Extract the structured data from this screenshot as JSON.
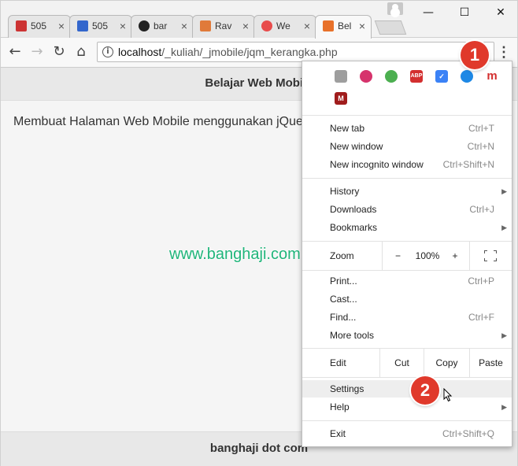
{
  "tabs": [
    {
      "title": "505",
      "favicon_color": "#cc3333"
    },
    {
      "title": "505",
      "favicon_color": "#3366cc"
    },
    {
      "title": "bar",
      "favicon_color": "#222222"
    },
    {
      "title": "Rav",
      "favicon_color": "#e07a3a"
    },
    {
      "title": "We",
      "favicon_color": "#e84c4c"
    },
    {
      "title": "Bel",
      "favicon_color": "#e8712a"
    }
  ],
  "window_controls": {
    "minimize": "—",
    "maximize": "☐",
    "close": "✕"
  },
  "toolbar": {
    "back": "←",
    "forward": "→",
    "reload": "↻",
    "home": "⌂",
    "url_host": "localhost",
    "url_path": "/_kuliah/_jmobile/jqm_kerangka.php",
    "menu_glyph": "⋮"
  },
  "page": {
    "header": "Belajar Web Mobile",
    "content": "Membuat Halaman Web Mobile menggunakan jQue",
    "footer": "banghaji dot com",
    "watermark": "www.banghaji.com"
  },
  "menu": {
    "extensions": [
      {
        "name": "camera-extension-icon",
        "color": "#9e9e9e",
        "text": ""
      },
      {
        "name": "donut-extension-icon",
        "color": "#d6336c",
        "text": ""
      },
      {
        "name": "color-picker-extension-icon",
        "color": "#4caf50",
        "text": ""
      },
      {
        "name": "adblock-plus-icon",
        "color": "#d32f2f",
        "text": "ABP"
      },
      {
        "name": "checkmark-extension-icon",
        "color": "#3b82f6",
        "text": "✓"
      },
      {
        "name": "dolphin-extension-icon",
        "color": "#1e88e5",
        "text": ""
      },
      {
        "name": "m-extension-icon",
        "color": "#ffffff",
        "text": "m"
      },
      {
        "name": "mendeley-extension-icon",
        "color": "#a01c1c",
        "text": "M"
      }
    ],
    "new_tab": {
      "label": "New tab",
      "shortcut": "Ctrl+T"
    },
    "new_window": {
      "label": "New window",
      "shortcut": "Ctrl+N"
    },
    "new_incognito": {
      "label": "New incognito window",
      "shortcut": "Ctrl+Shift+N"
    },
    "history": {
      "label": "History"
    },
    "downloads": {
      "label": "Downloads",
      "shortcut": "Ctrl+J"
    },
    "bookmarks": {
      "label": "Bookmarks"
    },
    "zoom": {
      "label": "Zoom",
      "minus": "−",
      "value": "100%",
      "plus": "+"
    },
    "print": {
      "label": "Print...",
      "shortcut": "Ctrl+P"
    },
    "cast": {
      "label": "Cast..."
    },
    "find": {
      "label": "Find...",
      "shortcut": "Ctrl+F"
    },
    "more_tools": {
      "label": "More tools"
    },
    "edit": {
      "label": "Edit",
      "cut": "Cut",
      "copy": "Copy",
      "paste": "Paste"
    },
    "settings": {
      "label": "Settings"
    },
    "help": {
      "label": "Help"
    },
    "exit": {
      "label": "Exit",
      "shortcut": "Ctrl+Shift+Q"
    }
  },
  "badges": {
    "one": "1",
    "two": "2"
  }
}
